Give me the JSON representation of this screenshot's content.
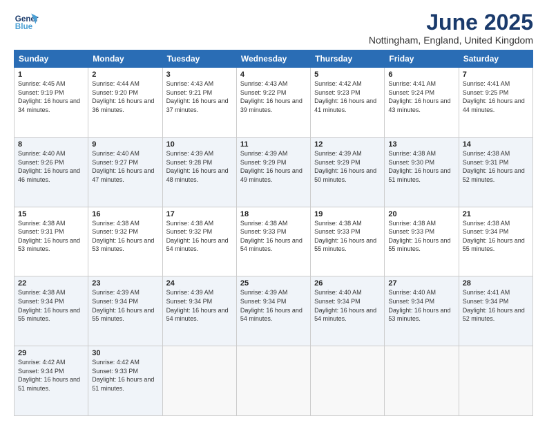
{
  "header": {
    "logo_line1": "General",
    "logo_line2": "Blue",
    "month_title": "June 2025",
    "location": "Nottingham, England, United Kingdom"
  },
  "weekdays": [
    "Sunday",
    "Monday",
    "Tuesday",
    "Wednesday",
    "Thursday",
    "Friday",
    "Saturday"
  ],
  "weeks": [
    [
      {
        "day": "1",
        "sunrise": "4:45 AM",
        "sunset": "9:19 PM",
        "daylight": "16 hours and 34 minutes."
      },
      {
        "day": "2",
        "sunrise": "4:44 AM",
        "sunset": "9:20 PM",
        "daylight": "16 hours and 36 minutes."
      },
      {
        "day": "3",
        "sunrise": "4:43 AM",
        "sunset": "9:21 PM",
        "daylight": "16 hours and 37 minutes."
      },
      {
        "day": "4",
        "sunrise": "4:43 AM",
        "sunset": "9:22 PM",
        "daylight": "16 hours and 39 minutes."
      },
      {
        "day": "5",
        "sunrise": "4:42 AM",
        "sunset": "9:23 PM",
        "daylight": "16 hours and 41 minutes."
      },
      {
        "day": "6",
        "sunrise": "4:41 AM",
        "sunset": "9:24 PM",
        "daylight": "16 hours and 43 minutes."
      },
      {
        "day": "7",
        "sunrise": "4:41 AM",
        "sunset": "9:25 PM",
        "daylight": "16 hours and 44 minutes."
      }
    ],
    [
      {
        "day": "8",
        "sunrise": "4:40 AM",
        "sunset": "9:26 PM",
        "daylight": "16 hours and 46 minutes."
      },
      {
        "day": "9",
        "sunrise": "4:40 AM",
        "sunset": "9:27 PM",
        "daylight": "16 hours and 47 minutes."
      },
      {
        "day": "10",
        "sunrise": "4:39 AM",
        "sunset": "9:28 PM",
        "daylight": "16 hours and 48 minutes."
      },
      {
        "day": "11",
        "sunrise": "4:39 AM",
        "sunset": "9:29 PM",
        "daylight": "16 hours and 49 minutes."
      },
      {
        "day": "12",
        "sunrise": "4:39 AM",
        "sunset": "9:29 PM",
        "daylight": "16 hours and 50 minutes."
      },
      {
        "day": "13",
        "sunrise": "4:38 AM",
        "sunset": "9:30 PM",
        "daylight": "16 hours and 51 minutes."
      },
      {
        "day": "14",
        "sunrise": "4:38 AM",
        "sunset": "9:31 PM",
        "daylight": "16 hours and 52 minutes."
      }
    ],
    [
      {
        "day": "15",
        "sunrise": "4:38 AM",
        "sunset": "9:31 PM",
        "daylight": "16 hours and 53 minutes."
      },
      {
        "day": "16",
        "sunrise": "4:38 AM",
        "sunset": "9:32 PM",
        "daylight": "16 hours and 53 minutes."
      },
      {
        "day": "17",
        "sunrise": "4:38 AM",
        "sunset": "9:32 PM",
        "daylight": "16 hours and 54 minutes."
      },
      {
        "day": "18",
        "sunrise": "4:38 AM",
        "sunset": "9:33 PM",
        "daylight": "16 hours and 54 minutes."
      },
      {
        "day": "19",
        "sunrise": "4:38 AM",
        "sunset": "9:33 PM",
        "daylight": "16 hours and 55 minutes."
      },
      {
        "day": "20",
        "sunrise": "4:38 AM",
        "sunset": "9:33 PM",
        "daylight": "16 hours and 55 minutes."
      },
      {
        "day": "21",
        "sunrise": "4:38 AM",
        "sunset": "9:34 PM",
        "daylight": "16 hours and 55 minutes."
      }
    ],
    [
      {
        "day": "22",
        "sunrise": "4:38 AM",
        "sunset": "9:34 PM",
        "daylight": "16 hours and 55 minutes."
      },
      {
        "day": "23",
        "sunrise": "4:39 AM",
        "sunset": "9:34 PM",
        "daylight": "16 hours and 55 minutes."
      },
      {
        "day": "24",
        "sunrise": "4:39 AM",
        "sunset": "9:34 PM",
        "daylight": "16 hours and 54 minutes."
      },
      {
        "day": "25",
        "sunrise": "4:39 AM",
        "sunset": "9:34 PM",
        "daylight": "16 hours and 54 minutes."
      },
      {
        "day": "26",
        "sunrise": "4:40 AM",
        "sunset": "9:34 PM",
        "daylight": "16 hours and 54 minutes."
      },
      {
        "day": "27",
        "sunrise": "4:40 AM",
        "sunset": "9:34 PM",
        "daylight": "16 hours and 53 minutes."
      },
      {
        "day": "28",
        "sunrise": "4:41 AM",
        "sunset": "9:34 PM",
        "daylight": "16 hours and 52 minutes."
      }
    ],
    [
      {
        "day": "29",
        "sunrise": "4:42 AM",
        "sunset": "9:34 PM",
        "daylight": "16 hours and 51 minutes."
      },
      {
        "day": "30",
        "sunrise": "4:42 AM",
        "sunset": "9:33 PM",
        "daylight": "16 hours and 51 minutes."
      },
      null,
      null,
      null,
      null,
      null
    ]
  ]
}
